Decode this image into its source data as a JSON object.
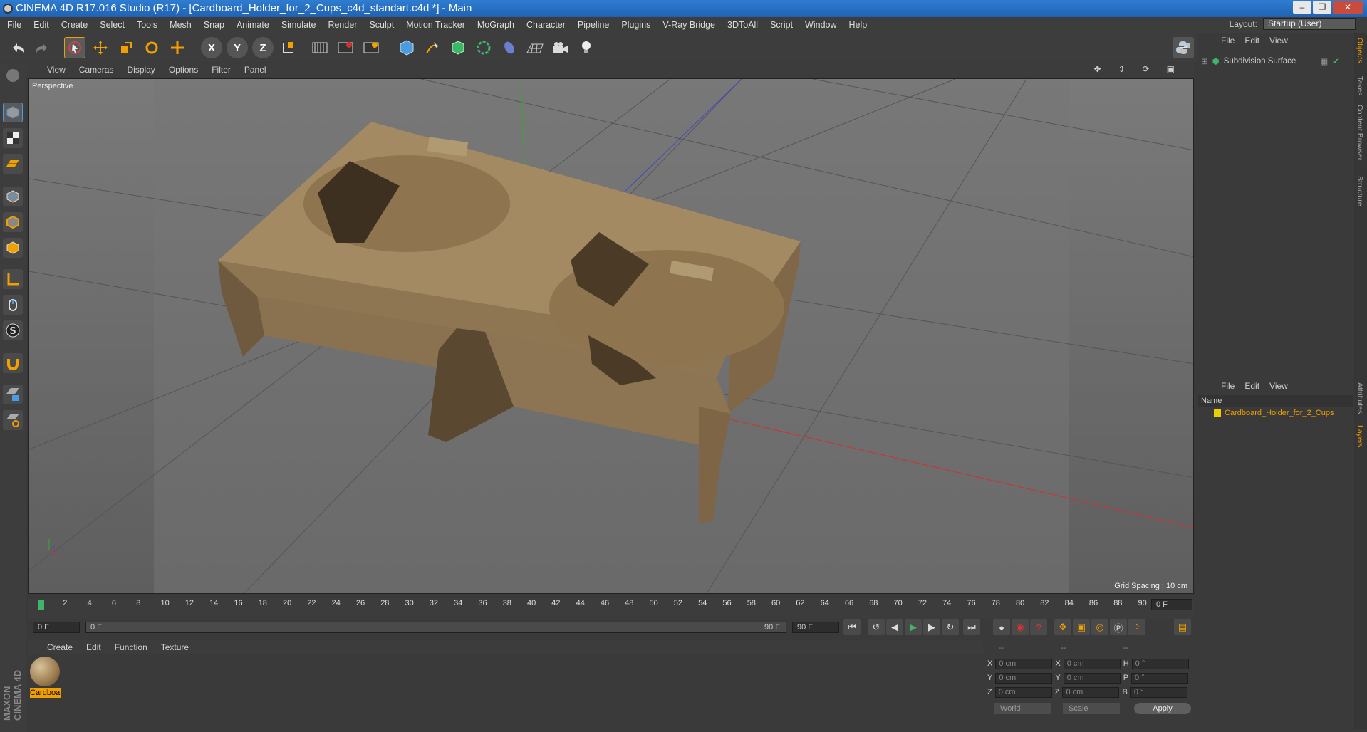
{
  "window": {
    "title": "CINEMA 4D R17.016 Studio (R17) - [Cardboard_Holder_for_2_Cups_c4d_standart.c4d *] - Main",
    "buttons": [
      "–",
      "❐",
      "✕"
    ]
  },
  "menu": [
    "File",
    "Edit",
    "Create",
    "Select",
    "Tools",
    "Mesh",
    "Snap",
    "Animate",
    "Simulate",
    "Render",
    "Sculpt",
    "Motion Tracker",
    "MoGraph",
    "Character",
    "Pipeline",
    "Plugins",
    "V-Ray Bridge",
    "3DToAll",
    "Script",
    "Window",
    "Help"
  ],
  "layout": {
    "label": "Layout:",
    "value": "Startup (User)"
  },
  "toolbar": {
    "x_label": "X",
    "y_label": "Y",
    "z_label": "Z"
  },
  "viewport": {
    "menu": [
      "View",
      "Cameras",
      "Display",
      "Options",
      "Filter",
      "Panel"
    ],
    "camera_label": "Perspective",
    "grid_spacing": "Grid Spacing : 10 cm"
  },
  "timeline": {
    "ticks": [
      "0",
      "2",
      "4",
      "6",
      "8",
      "10",
      "12",
      "14",
      "16",
      "18",
      "20",
      "22",
      "24",
      "26",
      "28",
      "30",
      "32",
      "34",
      "36",
      "38",
      "40",
      "42",
      "44",
      "46",
      "48",
      "50",
      "52",
      "54",
      "56",
      "58",
      "60",
      "62",
      "64",
      "66",
      "68",
      "70",
      "72",
      "74",
      "76",
      "78",
      "80",
      "82",
      "84",
      "86",
      "88",
      "90"
    ],
    "current_frame": "0 F",
    "start_field": "0 F",
    "range_start": "0 F",
    "range_end": "90 F",
    "end_field": "90 F"
  },
  "materials": {
    "menu": [
      "Create",
      "Edit",
      "Function",
      "Texture"
    ],
    "items": [
      {
        "label": "Cardboa"
      }
    ]
  },
  "coords": {
    "headers": [
      "--",
      "--",
      "--"
    ],
    "rows": [
      {
        "a_label": "X",
        "a_val": "0 cm",
        "b_label": "X",
        "b_val": "0 cm",
        "c_label": "H",
        "c_val": "0 °"
      },
      {
        "a_label": "Y",
        "a_val": "0 cm",
        "b_label": "Y",
        "b_val": "0 cm",
        "c_label": "P",
        "c_val": "0 °"
      },
      {
        "a_label": "Z",
        "a_val": "0 cm",
        "b_label": "Z",
        "b_val": "0 cm",
        "c_label": "B",
        "c_val": "0 °"
      }
    ],
    "world": "World",
    "scale": "Scale",
    "apply": "Apply"
  },
  "objects": {
    "menu": [
      "File",
      "Edit",
      "View"
    ],
    "items": [
      {
        "name": "Subdivision Surface"
      }
    ]
  },
  "layers": {
    "menu": [
      "File",
      "Edit",
      "View"
    ],
    "column": "Name",
    "items": [
      {
        "name": "Cardboard_Holder_for_2_Cups",
        "color": "#e8d000"
      }
    ]
  },
  "side_tabs": [
    "Objects",
    "Takes",
    "Content Browser",
    "Structure",
    "Attributes",
    "Layers"
  ],
  "branding": "MAXON CINEMA 4D",
  "colors": {
    "accent": "#f0a000",
    "title_bar": "#2f7dd1",
    "cardboard": "#a08560"
  }
}
